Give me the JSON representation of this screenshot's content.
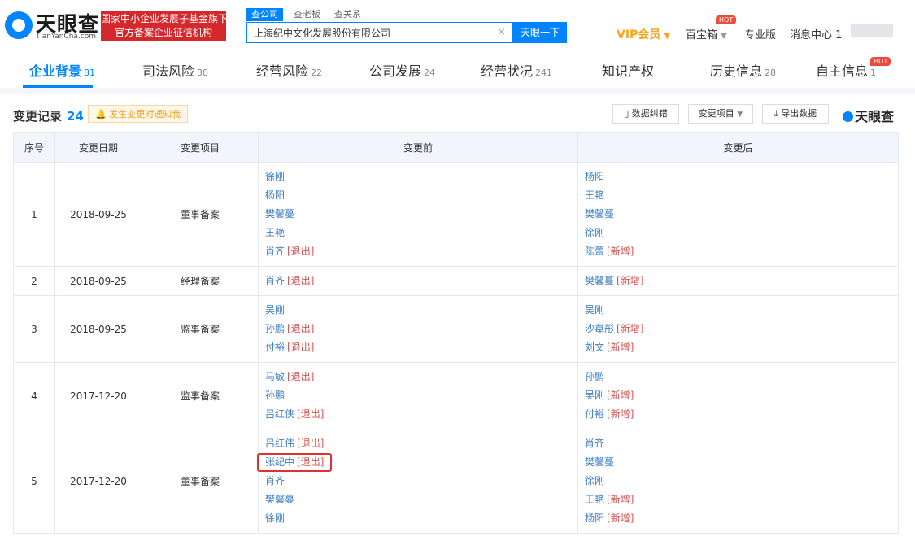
{
  "header": {
    "logo_title": "天眼查",
    "logo_sub": "TianYanCha.com",
    "badge_line1": "国家中小企业发展子基金旗下",
    "badge_line2": "官方备案企业征信机构",
    "search_tabs": [
      "查公司",
      "查老板",
      "查关系"
    ],
    "search_value": "上海纪中文化发展股份有限公司",
    "clear_icon": "×",
    "search_button": "天眼一下",
    "vip_label": "VIP会员",
    "treasure_label": "百宝箱",
    "hot_badge": "HOT",
    "pro_label": "专业版",
    "message_label": "消息中心",
    "message_count": "1"
  },
  "tabs": [
    {
      "label": "企业背景",
      "count": "81"
    },
    {
      "label": "司法风险",
      "count": "38"
    },
    {
      "label": "经营风险",
      "count": "22"
    },
    {
      "label": "公司发展",
      "count": "24"
    },
    {
      "label": "经营状况",
      "count": "241"
    },
    {
      "label": "知识产权",
      "count": ""
    },
    {
      "label": "历史信息",
      "count": "28"
    },
    {
      "label": "自主信息",
      "count": "1"
    }
  ],
  "section": {
    "title": "变更记录",
    "count": "24",
    "notify_label": "发生变更时通知我",
    "correct_button": "数据纠错",
    "change_item_button": "变更项目",
    "export_button": "导出数据",
    "brand": "天眼查"
  },
  "table": {
    "headers": [
      "序号",
      "变更日期",
      "变更项目",
      "变更前",
      "变更后"
    ],
    "rows": [
      {
        "index": "1",
        "date": "2018-09-25",
        "item": "董事备案",
        "before": [
          {
            "name": "徐刚"
          },
          {
            "name": "杨阳"
          },
          {
            "name": "樊馨蔓"
          },
          {
            "name": "王艳"
          },
          {
            "name": "肖齐",
            "tag": "[退出]"
          }
        ],
        "after": [
          {
            "name": "杨阳"
          },
          {
            "name": "王艳"
          },
          {
            "name": "樊馨蔓"
          },
          {
            "name": "徐刚"
          },
          {
            "name": "陈蕾",
            "tag": "[新增]"
          }
        ]
      },
      {
        "index": "2",
        "date": "2018-09-25",
        "item": "经理备案",
        "before": [
          {
            "name": "肖齐",
            "tag": "[退出]"
          }
        ],
        "after": [
          {
            "name": "樊馨蔓",
            "tag": "[新增]"
          }
        ]
      },
      {
        "index": "3",
        "date": "2018-09-25",
        "item": "监事备案",
        "before": [
          {
            "name": "吴刚"
          },
          {
            "name": "孙鹏",
            "tag": "[退出]"
          },
          {
            "name": "付裕",
            "tag": "[退出]"
          }
        ],
        "after": [
          {
            "name": "吴刚"
          },
          {
            "name": "沙韋彤",
            "tag": "[新增]"
          },
          {
            "name": "刘文",
            "tag": "[新增]"
          }
        ]
      },
      {
        "index": "4",
        "date": "2017-12-20",
        "item": "监事备案",
        "before": [
          {
            "name": "马敏",
            "tag": "[退出]"
          },
          {
            "name": "孙鹏"
          },
          {
            "name": "吕红侠",
            "tag": "[退出]"
          }
        ],
        "after": [
          {
            "name": "孙鹏"
          },
          {
            "name": "吴刚",
            "tag": "[新增]"
          },
          {
            "name": "付裕",
            "tag": "[新增]"
          }
        ]
      },
      {
        "index": "5",
        "date": "2017-12-20",
        "item": "董事备案",
        "before": [
          {
            "name": "吕红伟",
            "tag": "[退出]"
          },
          {
            "name": "张纪中",
            "tag": "[退出]",
            "highlight": true
          },
          {
            "name": "肖齐"
          },
          {
            "name": "樊馨蔓"
          },
          {
            "name": "徐刚"
          }
        ],
        "after": [
          {
            "name": "肖齐"
          },
          {
            "name": "樊馨蔓"
          },
          {
            "name": "徐刚"
          },
          {
            "name": "王艳",
            "tag": "[新增]"
          },
          {
            "name": "杨阳",
            "tag": "[新增]"
          }
        ]
      }
    ]
  },
  "colors": {
    "brand": "#0084ff",
    "exit_tag": "#d9534f",
    "name_link": "#3d7fc4",
    "highlight_box": "#e03131",
    "vip": "#f6a623"
  }
}
